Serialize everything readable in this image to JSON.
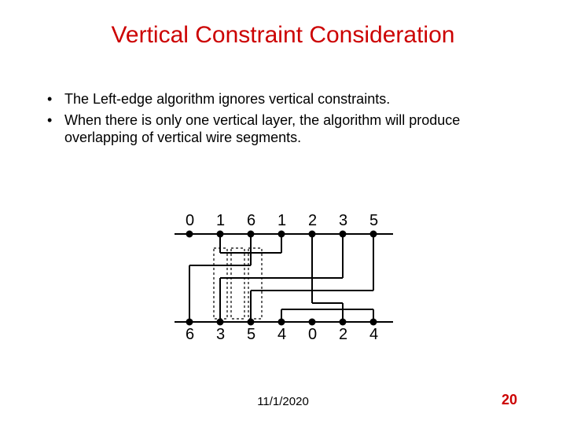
{
  "title": "Vertical Constraint Consideration",
  "bullets": [
    "The Left-edge algorithm ignores vertical constraints.",
    "When there is only one vertical layer, the algorithm will produce overlapping of vertical wire segments."
  ],
  "top_labels": [
    "0",
    "1",
    "6",
    "1",
    "2",
    "3",
    "5"
  ],
  "bottom_labels": [
    "6",
    "3",
    "5",
    "4",
    "0",
    "2",
    "4"
  ],
  "date": "11/1/2020",
  "page": "20"
}
